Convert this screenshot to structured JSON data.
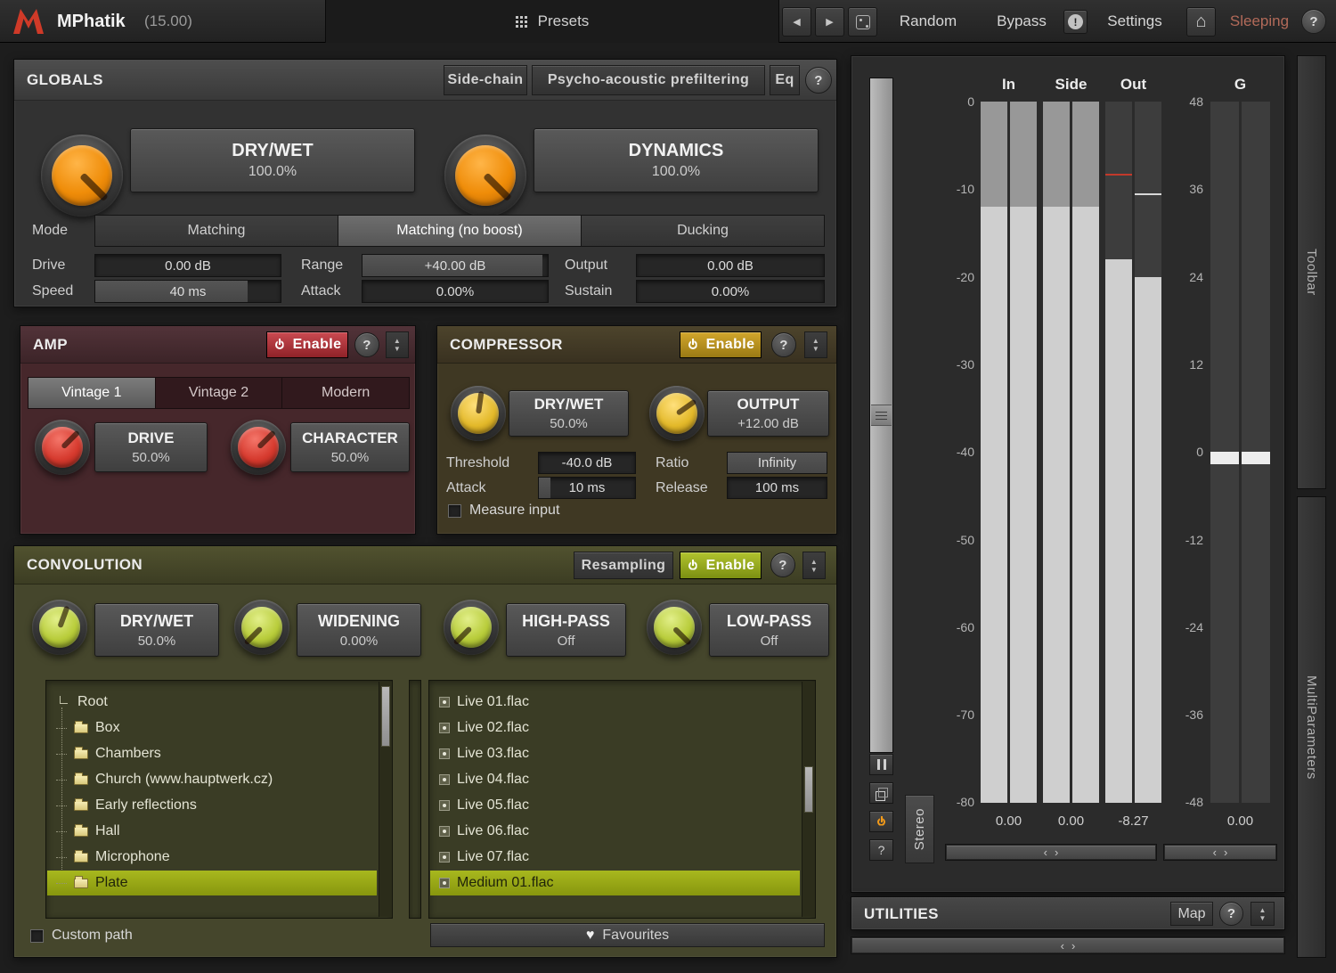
{
  "topbar": {
    "app_name": "MPhatik",
    "app_version": "(15.00)",
    "presets_label": "Presets",
    "random_label": "Random",
    "bypass_label": "Bypass",
    "warning_label": "!",
    "settings_label": "Settings",
    "sleeping_label": "Sleeping",
    "help_label": "?"
  },
  "globals": {
    "title": "GLOBALS",
    "header_buttons": [
      {
        "label": "Side-chain"
      },
      {
        "label": "Psycho-acoustic prefiltering"
      },
      {
        "label": "Eq"
      }
    ],
    "help_label": "?",
    "knobs": [
      {
        "label": "DRY/WET",
        "value": "100.0%"
      },
      {
        "label": "DYNAMICS",
        "value": "100.0%"
      }
    ],
    "mode_label": "Mode",
    "modes": [
      {
        "label": "Matching"
      },
      {
        "label": "Matching (no boost)"
      },
      {
        "label": "Ducking"
      }
    ],
    "selected_mode": "Matching (no boost)",
    "params": [
      {
        "label": "Drive",
        "value": "0.00 dB"
      },
      {
        "label": "Range",
        "value": "+40.00 dB"
      },
      {
        "label": "Output",
        "value": "0.00 dB"
      },
      {
        "label": "Speed",
        "value": "40 ms"
      },
      {
        "label": "Attack",
        "value": "0.00%"
      },
      {
        "label": "Sustain",
        "value": "0.00%"
      }
    ]
  },
  "amp": {
    "title": "AMP",
    "enable_label": "Enable",
    "help_label": "?",
    "tabs": [
      {
        "label": "Vintage 1"
      },
      {
        "label": "Vintage 2"
      },
      {
        "label": "Modern"
      }
    ],
    "selected_tab": "Vintage 1",
    "knobs": [
      {
        "label": "DRIVE",
        "value": "50.0%"
      },
      {
        "label": "CHARACTER",
        "value": "50.0%"
      }
    ]
  },
  "compressor": {
    "title": "COMPRESSOR",
    "enable_label": "Enable",
    "help_label": "?",
    "knobs": [
      {
        "label": "DRY/WET",
        "value": "50.0%"
      },
      {
        "label": "OUTPUT",
        "value": "+12.00 dB"
      }
    ],
    "params": [
      {
        "label": "Threshold",
        "value": "-40.0 dB"
      },
      {
        "label": "Ratio",
        "value": "Infinity"
      },
      {
        "label": "Attack",
        "value": "10 ms"
      },
      {
        "label": "Release",
        "value": "100 ms"
      }
    ],
    "measure_input_label": "Measure input"
  },
  "convolution": {
    "title": "CONVOLUTION",
    "resampling_label": "Resampling",
    "enable_label": "Enable",
    "help_label": "?",
    "knobs": [
      {
        "label": "DRY/WET",
        "value": "50.0%"
      },
      {
        "label": "WIDENING",
        "value": "0.00%"
      },
      {
        "label": "HIGH-PASS",
        "value": "Off"
      },
      {
        "label": "LOW-PASS",
        "value": "Off"
      }
    ],
    "tree": {
      "root_label": "Root",
      "items": [
        {
          "label": "Box"
        },
        {
          "label": "Chambers"
        },
        {
          "label": "Church (www.hauptwerk.cz)"
        },
        {
          "label": "Early reflections"
        },
        {
          "label": "Hall"
        },
        {
          "label": "Microphone"
        },
        {
          "label": "Plate"
        }
      ],
      "selected": "Plate"
    },
    "files": {
      "items": [
        {
          "label": "Live 01.flac"
        },
        {
          "label": "Live 02.flac"
        },
        {
          "label": "Live 03.flac"
        },
        {
          "label": "Live 04.flac"
        },
        {
          "label": "Live 05.flac"
        },
        {
          "label": "Live 06.flac"
        },
        {
          "label": "Live 07.flac"
        },
        {
          "label": "Medium 01.flac"
        }
      ],
      "selected": "Medium 01.flac"
    },
    "custom_path_label": "Custom path",
    "favourites_label": "Favourites"
  },
  "meters": {
    "columns": [
      {
        "label": "In",
        "readout": "0.00"
      },
      {
        "label": "Side",
        "readout": "0.00"
      },
      {
        "label": "Out",
        "readout": "-8.27"
      },
      {
        "label": "G",
        "readout": "0.00"
      }
    ],
    "db_scale": [
      "0",
      "-10",
      "-20",
      "-30",
      "-40",
      "-50",
      "-60",
      "-70",
      "-80"
    ],
    "g_scale": [
      "48",
      "36",
      "24",
      "12",
      "0",
      "-12",
      "-24",
      "-36",
      "-48"
    ],
    "stereo_label": "Stereo",
    "help_label": "?"
  },
  "utilities": {
    "title": "UTILITIES",
    "map_label": "Map",
    "help_label": "?"
  },
  "strips": {
    "toolbar_label": "Toolbar",
    "multiparameters_label": "MultiParameters"
  },
  "colors": {
    "accent_orange": "#ef8c08",
    "accent_red": "#d63a2e",
    "accent_yellow": "#e3b92a",
    "accent_green": "#b8cc3a",
    "selection": "#9aaa14"
  }
}
